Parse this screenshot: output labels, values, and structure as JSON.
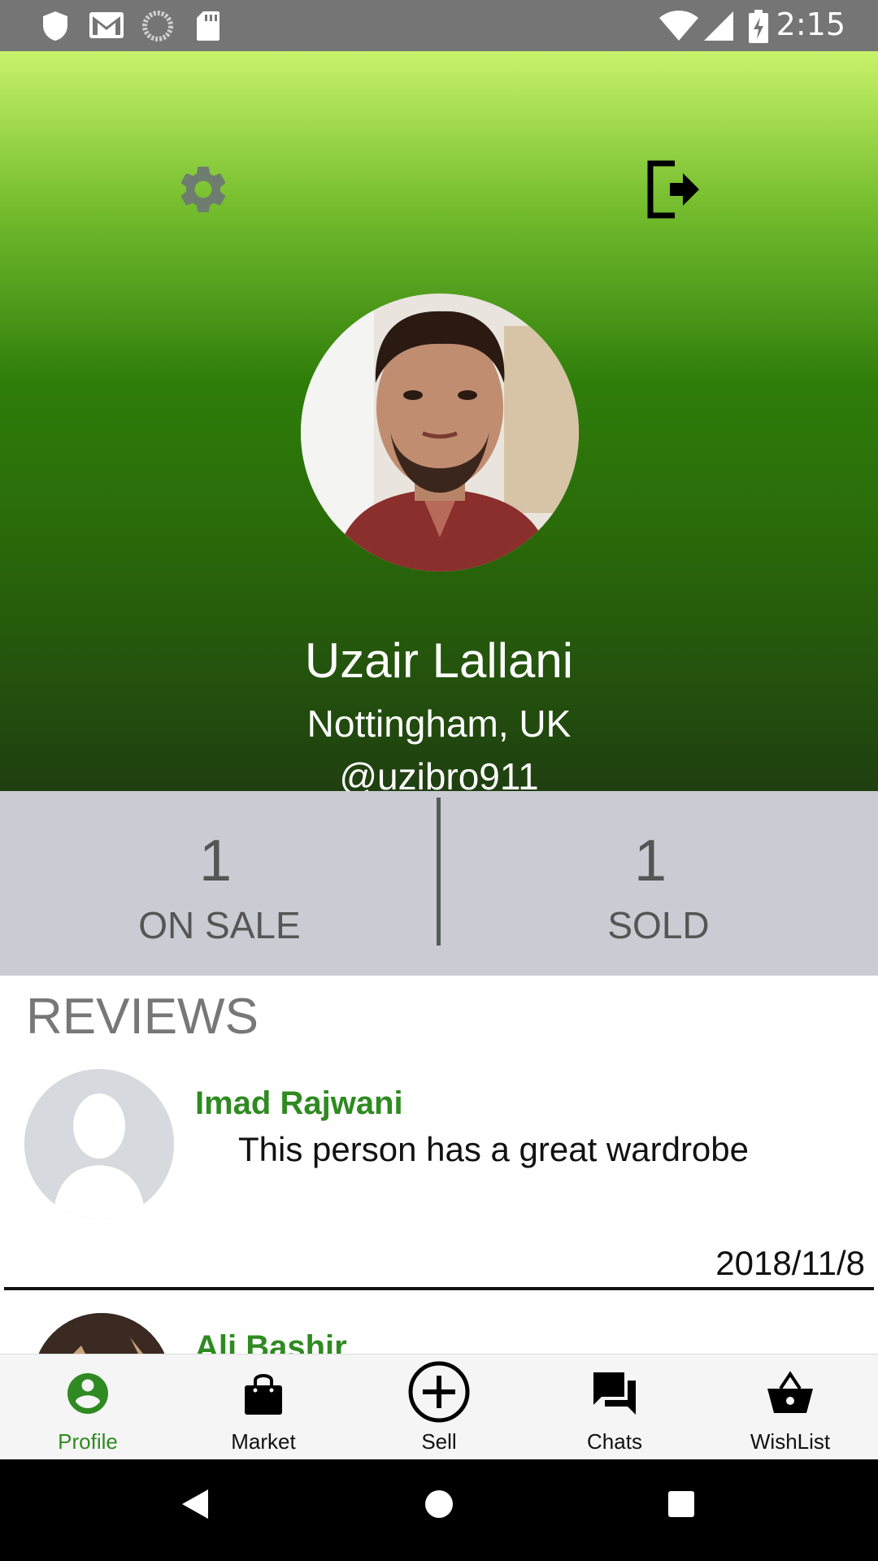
{
  "status_bar": {
    "time": "2:15",
    "left_icons": [
      "shield-icon",
      "gmail-icon",
      "sync-icon",
      "sd-card-icon"
    ],
    "right_icons": [
      "wifi-icon",
      "signal-icon",
      "battery-charging-icon"
    ]
  },
  "header": {
    "settings_icon": "gear-icon",
    "logout_icon": "logout-icon"
  },
  "profile": {
    "name": "Uzair Lallani",
    "location": "Nottingham, UK",
    "handle": "@uzibro911"
  },
  "stats": {
    "on_sale": {
      "value": "1",
      "label": "ON SALE"
    },
    "sold": {
      "value": "1",
      "label": "SOLD"
    }
  },
  "reviews": {
    "title": "REVIEWS",
    "items": [
      {
        "reviewer": "Imad Rajwani",
        "text": "This person has a great wardrobe",
        "date": "2018/11/8"
      },
      {
        "reviewer": "Ali Bashir"
      }
    ]
  },
  "bottom_nav": {
    "items": [
      {
        "label": "Profile",
        "icon": "account-circle-icon",
        "active": true
      },
      {
        "label": "Market",
        "icon": "shopping-bag-icon"
      },
      {
        "label": "Sell",
        "icon": "add-circle-icon"
      },
      {
        "label": "Chats",
        "icon": "chat-icon"
      },
      {
        "label": "WishList",
        "icon": "basket-icon"
      }
    ]
  },
  "colors": {
    "accent": "#2f8a21",
    "stats_background": "#cbcbd3",
    "status_bar": "#757575"
  }
}
